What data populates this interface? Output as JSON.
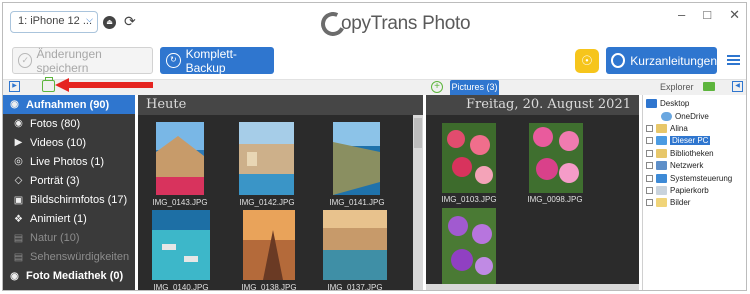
{
  "header": {
    "device_label": "1: iPhone 12 ...",
    "app_title": "opyTrans Photo",
    "colors": {
      "accent": "#2f76cf",
      "green": "#5db53d",
      "bulb": "#f6c51c",
      "sidebar_bg": "#3a3a3a",
      "panel_bg": "#2b2b2b",
      "arrow": "#e52420"
    }
  },
  "toolbar": {
    "save_label": "Änderungen speichern",
    "backup_label": "Komplett-Backup",
    "guides_label": "Kurzanleitungen"
  },
  "pictures_tab": "Pictures (3)",
  "explorer_label": "Explorer",
  "sidebar": {
    "items": [
      {
        "label": "Aufnahmen (90)",
        "icon": "camera-icon"
      },
      {
        "label": "Fotos (80)",
        "icon": "camera-icon"
      },
      {
        "label": "Videos (10)",
        "icon": "video-icon"
      },
      {
        "label": "Live Photos (1)",
        "icon": "live-photo-icon"
      },
      {
        "label": "Porträt (3)",
        "icon": "cube-icon"
      },
      {
        "label": "Bildschirmfotos (17)",
        "icon": "screenshot-icon"
      },
      {
        "label": "Animiert (1)",
        "icon": "animated-icon"
      },
      {
        "label": "Natur (10)",
        "icon": "album-icon"
      },
      {
        "label": "Sehenswürdigkeiten",
        "icon": "album-icon"
      },
      {
        "label": "Foto Mediathek (0)",
        "icon": "camera-icon"
      }
    ]
  },
  "center_panel": {
    "heading": "Heute",
    "photos": [
      {
        "name": "IMG_0143.JPG"
      },
      {
        "name": "IMG_0142.JPG"
      },
      {
        "name": "IMG_0141.JPG"
      },
      {
        "name": "IMG_0140.JPG"
      },
      {
        "name": "IMG_0138.JPG"
      },
      {
        "name": "IMG_0137.JPG"
      }
    ]
  },
  "right_panel": {
    "heading": "Freitag, 20. August 2021",
    "photos": [
      {
        "name": "IMG_0103.JPG"
      },
      {
        "name": "IMG_0098.JPG"
      },
      {
        "name": ""
      }
    ]
  },
  "explorer": {
    "items": [
      {
        "label": "Desktop"
      },
      {
        "label": "OneDrive"
      },
      {
        "label": "Alina"
      },
      {
        "label": "Dieser PC"
      },
      {
        "label": "Bibliotheken"
      },
      {
        "label": "Netzwerk"
      },
      {
        "label": "Systemsteuerung"
      },
      {
        "label": "Papierkorb"
      },
      {
        "label": "Bilder"
      }
    ]
  }
}
